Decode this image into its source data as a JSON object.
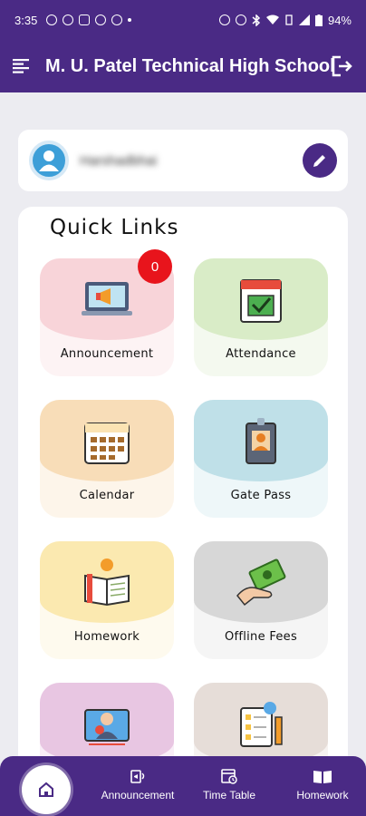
{
  "status_bar": {
    "time": "3:35",
    "battery": "94%",
    "icons": [
      "skype-icon",
      "a-icon",
      "youtube-icon",
      "cloud-icon",
      "weather-icon",
      "dot",
      "alarm-icon",
      "mute-icon",
      "bluetooth-icon",
      "wifi-icon",
      "vibrate-icon",
      "signal-icon",
      "battery-icon"
    ]
  },
  "app_bar": {
    "title": "M. U. Patel Technical High School"
  },
  "profile": {
    "name": "Harshadbhai"
  },
  "quick_links": {
    "title": "Quick Links",
    "tiles": [
      {
        "label": "Announcement",
        "color": "#f8d4d9",
        "badge": "0",
        "icon": "megaphone-laptop-icon"
      },
      {
        "label": "Attendance",
        "color": "#d9ecc7",
        "icon": "calendar-check-icon"
      },
      {
        "label": "Calendar",
        "color": "#f8ddb8",
        "icon": "calendar-grid-icon"
      },
      {
        "label": "Gate Pass",
        "color": "#bfe0e8",
        "icon": "id-badge-icon"
      },
      {
        "label": "Homework",
        "color": "#fbe9b0",
        "icon": "book-pencil-icon"
      },
      {
        "label": "Offline Fees",
        "color": "#d7d7d7",
        "icon": "cash-hand-icon"
      },
      {
        "label": "",
        "color": "#e8c6e2",
        "icon": "video-lecture-icon"
      },
      {
        "label": "",
        "color": "#e6ddd8",
        "icon": "quiz-sheet-icon"
      }
    ]
  },
  "bottom_nav": {
    "home_icon": "home-icon",
    "items": [
      {
        "label": "Announcement",
        "icon": "announcement-icon"
      },
      {
        "label": "Time Table",
        "icon": "timetable-icon"
      },
      {
        "label": "Homework",
        "icon": "book-icon"
      }
    ]
  },
  "colors": {
    "primary": "#4a2a85",
    "background": "#ececf1",
    "badge": "#e8141c",
    "avatar": "#3d9fd8"
  }
}
